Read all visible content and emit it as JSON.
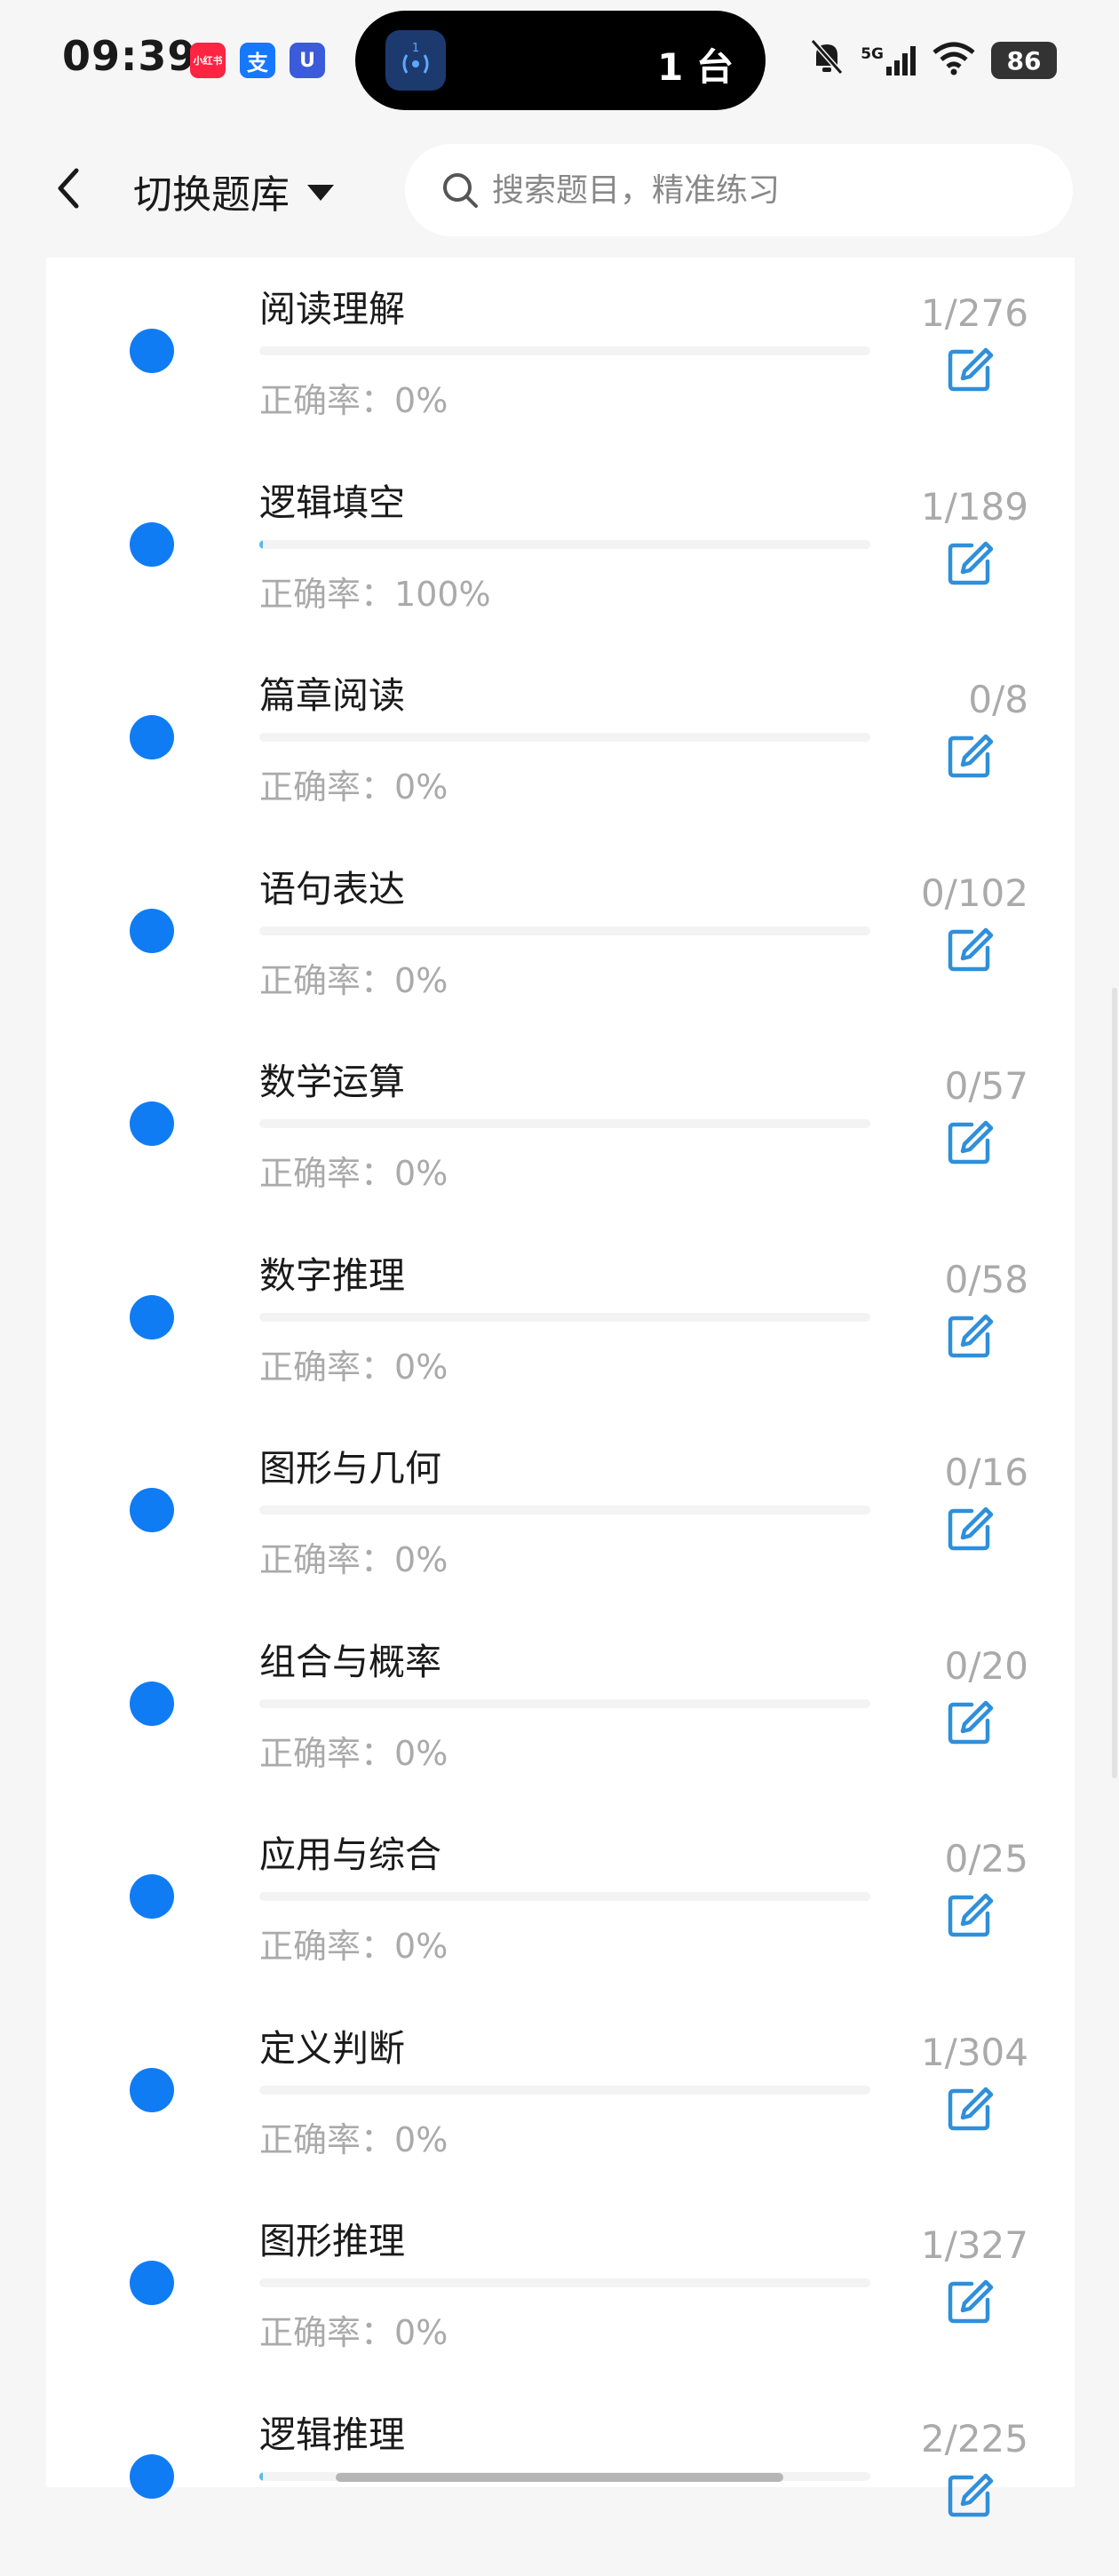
{
  "status_bar": {
    "time": "09:39",
    "apps": [
      {
        "name": "xiaohongshu",
        "label": "小红书",
        "color": "#ff2442"
      },
      {
        "name": "alipay",
        "label": "支",
        "color": "#1677ff"
      },
      {
        "name": "shield-app",
        "label": "U",
        "color": "#3b5bdb"
      }
    ],
    "island_text": "1 台",
    "network": "5G",
    "battery": "86"
  },
  "header": {
    "title": "切换题库",
    "search_placeholder": "搜索题目，精准练习"
  },
  "accuracy_label": "正确率：",
  "items": [
    {
      "title": "阅读理解",
      "accuracy": "0%",
      "count": "1/276",
      "progress": 0.0
    },
    {
      "title": "逻辑填空",
      "accuracy": "100%",
      "count": "1/189",
      "progress": 0.005
    },
    {
      "title": "篇章阅读",
      "accuracy": "0%",
      "count": "0/8",
      "progress": 0
    },
    {
      "title": "语句表达",
      "accuracy": "0%",
      "count": "0/102",
      "progress": 0
    },
    {
      "title": "数学运算",
      "accuracy": "0%",
      "count": "0/57",
      "progress": 0
    },
    {
      "title": "数字推理",
      "accuracy": "0%",
      "count": "0/58",
      "progress": 0
    },
    {
      "title": "图形与几何",
      "accuracy": "0%",
      "count": "0/16",
      "progress": 0
    },
    {
      "title": "组合与概率",
      "accuracy": "0%",
      "count": "0/20",
      "progress": 0
    },
    {
      "title": "应用与综合",
      "accuracy": "0%",
      "count": "0/25",
      "progress": 0
    },
    {
      "title": "定义判断",
      "accuracy": "0%",
      "count": "1/304",
      "progress": 0
    },
    {
      "title": "图形推理",
      "accuracy": "0%",
      "count": "1/327",
      "progress": 0
    },
    {
      "title": "逻辑推理",
      "accuracy": "",
      "count": "2/225",
      "progress": 0.005
    }
  ],
  "colors": {
    "dot": "#0f7cf3",
    "edit_icon": "#2f8fdb",
    "progress_fill": "#5bb8e4"
  }
}
